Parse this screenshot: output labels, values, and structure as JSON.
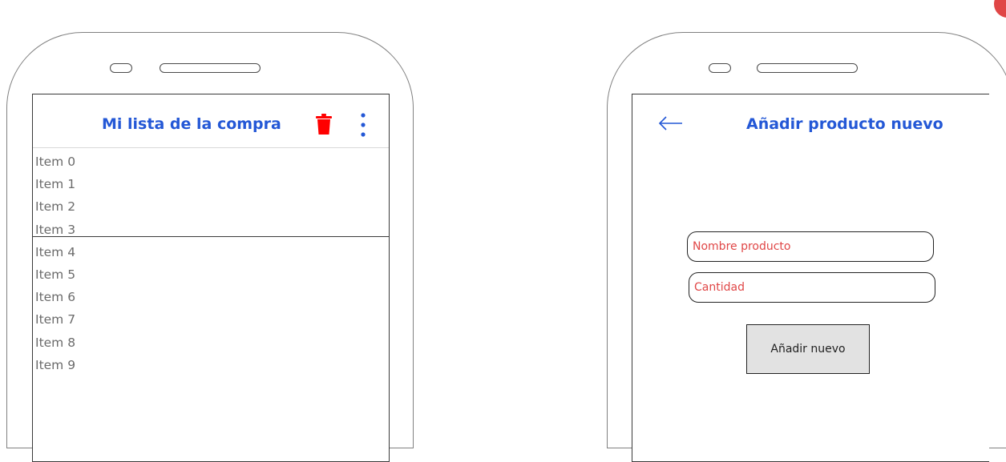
{
  "colors": {
    "accent": "#2458d6",
    "danger": "#ff0000",
    "placeholder_text": "#e04646",
    "button_bg": "#e2e2e2"
  },
  "list_screen": {
    "title": "Mi lista de la compra",
    "icons": [
      "trash-icon",
      "more-vert-icon"
    ],
    "items": [
      "Item 0",
      "Item 1",
      "Item 2",
      "Item 3",
      "Item 4",
      "Item 5",
      "Item 6",
      "Item 7",
      "Item 8",
      "Item 9"
    ]
  },
  "add_screen": {
    "title": "Añadir producto nuevo",
    "icons": [
      "back-arrow-icon"
    ],
    "name_placeholder": "Nombre producto",
    "quantity_placeholder": "Cantidad",
    "add_button_label": "Añadir nuevo"
  }
}
